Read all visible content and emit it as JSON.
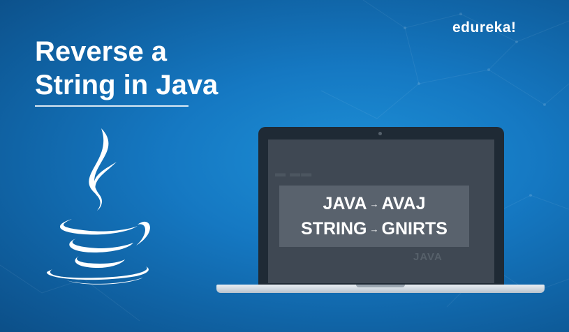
{
  "brand": "edureka!",
  "title": {
    "line1": "Reverse a",
    "line2": "String in Java"
  },
  "screen": {
    "rows": [
      {
        "input": "JAVA",
        "arrow": "→",
        "output": "AVAJ"
      },
      {
        "input": "STRING",
        "arrow": "→",
        "output": "GNIRTS"
      }
    ],
    "watermark": "JAVA"
  },
  "icons": {
    "logo": "java-coffee-cup-icon",
    "device": "laptop-icon"
  },
  "colors": {
    "background": "#1578c2",
    "text": "#ffffff",
    "screen": "#3f4853",
    "panel": "#59626d"
  }
}
